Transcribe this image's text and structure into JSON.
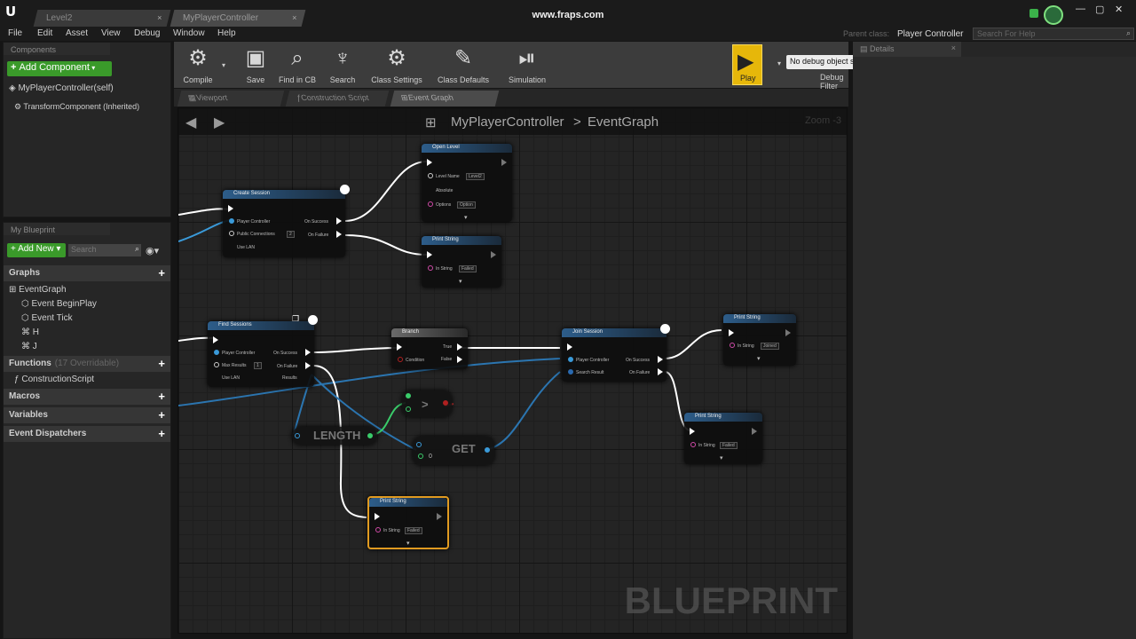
{
  "titlebar": {
    "tabs": [
      {
        "label": "Level2"
      },
      {
        "label": "MyPlayerController"
      }
    ],
    "watermark": "www.fraps.com"
  },
  "menu": {
    "items": [
      "File",
      "Edit",
      "Asset",
      "View",
      "Debug",
      "Window",
      "Help"
    ],
    "parent_class_label": "Parent class:",
    "parent_class_value": "Player Controller",
    "search_placeholder": "Search For Help"
  },
  "components": {
    "header": "Components",
    "add_button": "Add Component",
    "items": [
      "MyPlayerController(self)",
      "TransformComponent (Inherited)"
    ]
  },
  "myblueprint": {
    "header": "My Blueprint",
    "add_button": "Add New",
    "search_placeholder": "Search",
    "graphs_label": "Graphs",
    "graphs": [
      "EventGraph",
      "Event BeginPlay",
      "Event Tick",
      "H",
      "J"
    ],
    "functions_label": "Functions",
    "functions_count": "(17 Overridable)",
    "functions": [
      "ConstructionScript"
    ],
    "macros_label": "Macros",
    "variables_label": "Variables",
    "dispatchers_label": "Event Dispatchers"
  },
  "toolbar": {
    "buttons": [
      "Compile",
      "Save",
      "Find in CB",
      "Search",
      "Class Settings",
      "Class Defaults",
      "Simulation",
      "Play"
    ],
    "debug_select": "No debug object selected",
    "debug_filter": "Debug Filter"
  },
  "editor_tabs": [
    "Viewport",
    "Construction Script",
    "Event Graph"
  ],
  "graph": {
    "breadcrumb_root": "MyPlayerController",
    "breadcrumb_sep": ">",
    "breadcrumb_leaf": "EventGraph",
    "zoom": "Zoom -3",
    "watermark": "BLUEPRINT",
    "nodes": {
      "create_session": {
        "title": "Create Session",
        "pins": [
          "Player Controller",
          "Public Connections",
          "Use LAN"
        ],
        "outs": [
          "On Success",
          "On Failure"
        ],
        "value": "2"
      },
      "open_level": {
        "title": "Open Level",
        "pins": [
          "Level Name",
          "Absolute",
          "Options"
        ],
        "values": [
          "Level2",
          "",
          "Option"
        ]
      },
      "print_string_1": {
        "title": "Print String",
        "pin": "In String",
        "value": "Failed"
      },
      "find_sessions": {
        "title": "Find Sessions",
        "pins": [
          "Player Controller",
          "Max Results",
          "Use LAN"
        ],
        "outs": [
          "On Success",
          "On Failure",
          "Results"
        ],
        "value": "1"
      },
      "branch": {
        "title": "Branch",
        "pins": [
          "Condition"
        ],
        "outs": [
          "True",
          "False"
        ]
      },
      "join_session": {
        "title": "Join Session",
        "pins": [
          "Player Controller",
          "Search Result"
        ],
        "outs": [
          "On Success",
          "On Failure"
        ]
      },
      "print_string_2": {
        "title": "Print String",
        "pin": "In String",
        "value": "Joined"
      },
      "print_string_3": {
        "title": "Print String",
        "pin": "In String",
        "value": "Failed"
      },
      "print_string_4": {
        "title": "Print String",
        "pin": "In String",
        "value": "Failed"
      },
      "length": {
        "label": "LENGTH"
      },
      "get": {
        "label": "GET",
        "index": "0"
      },
      "greater": {
        "label": ">"
      }
    }
  },
  "details": {
    "header": "Details"
  }
}
